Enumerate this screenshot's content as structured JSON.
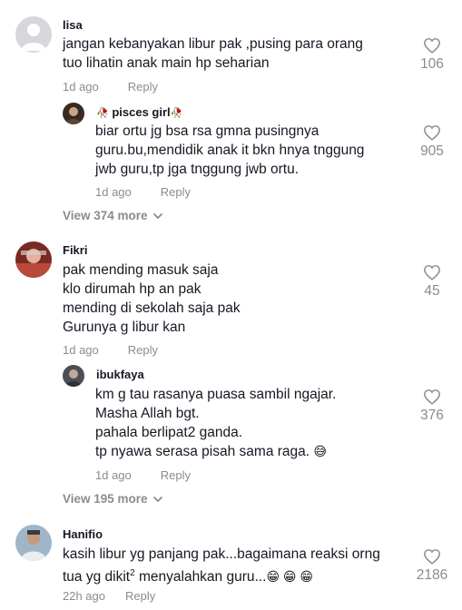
{
  "comments": [
    {
      "username": "lisa",
      "lines": [
        "jangan kebanyakan libur pak ,pusing para orang",
        "tuo lihatin anak main hp seharian"
      ],
      "time": "1d ago",
      "reply_label": "Reply",
      "likes": "106",
      "replies": [
        {
          "username": "pisces girl",
          "username_decor": "🥀",
          "lines": [
            "biar ortu jg bsa rsa gmna pusingnya",
            "guru.bu,mendidik anak it bkn hnya tnggung",
            "jwb guru,tp jga tnggung jwb ortu."
          ],
          "time": "1d ago",
          "reply_label": "Reply",
          "likes": "905"
        }
      ],
      "view_more": "View 374 more"
    },
    {
      "username": "Fikri",
      "lines": [
        "pak mending masuk saja",
        "klo dirumah hp an pak",
        "mending di sekolah saja pak",
        "Gurunya g libur kan"
      ],
      "time": "1d ago",
      "reply_label": "Reply",
      "likes": "45",
      "replies": [
        {
          "username": "ibukfaya",
          "lines": [
            "km g tau rasanya puasa sambil ngajar.",
            "Masha Allah bgt.",
            "pahala berlipat2 ganda.",
            "tp nyawa serasa pisah sama raga."
          ],
          "emoji": "😅",
          "time": "1d ago",
          "reply_label": "Reply",
          "likes": "376"
        }
      ],
      "view_more": "View 195 more"
    },
    {
      "username": "Hanifio",
      "lines": [
        "kasih libur yg panjang pak...bagaimana reaksi orng",
        "tua yg dikit"
      ],
      "superscript": "2",
      "line2_tail": " menyalahkan guru...",
      "emoji": "😁 😁 😁",
      "time": "22h ago",
      "reply_label": "Reply",
      "likes": "2186"
    }
  ]
}
